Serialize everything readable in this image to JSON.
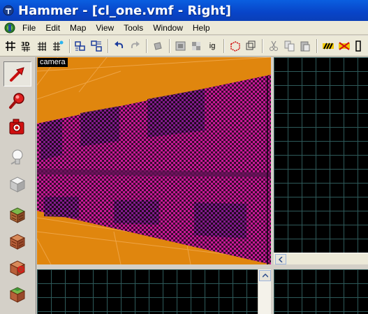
{
  "window": {
    "title": "Hammer - [cl_one.vmf - Right]"
  },
  "menu": {
    "items": [
      "File",
      "Edit",
      "Map",
      "View",
      "Tools",
      "Window",
      "Help"
    ]
  },
  "toolbar": {
    "buttons": [
      "grid-toggle",
      "grid-3d-toggle",
      "grid-smaller",
      "grid-larger",
      "group",
      "ungroup",
      "undo",
      "redo",
      "carve",
      "hollow",
      "texture-lock",
      "ignore-groups",
      "cordon",
      "cordon-edit",
      "cut",
      "copy",
      "paste",
      "hide-items",
      "show-items",
      "radius-cull"
    ],
    "ignore_groups_label": "ig"
  },
  "palette": {
    "tools": [
      "selection-tool",
      "magnify-tool",
      "camera-tool",
      "entity-tool",
      "block-tool",
      "texture-application-tool",
      "apply-current-texture-tool",
      "decal-tool",
      "overlay-tool"
    ],
    "active_tool": "selection-tool"
  },
  "viewports": {
    "camera": {
      "label": "camera"
    }
  },
  "colors": {
    "title_bar": "#0a5fe0",
    "viewport_background": "#000000",
    "grid_line": "#2e5a5a",
    "orange_wall": "#e0860e",
    "checker_magenta": "#c81896",
    "checker_dark": "#3a0a30"
  }
}
